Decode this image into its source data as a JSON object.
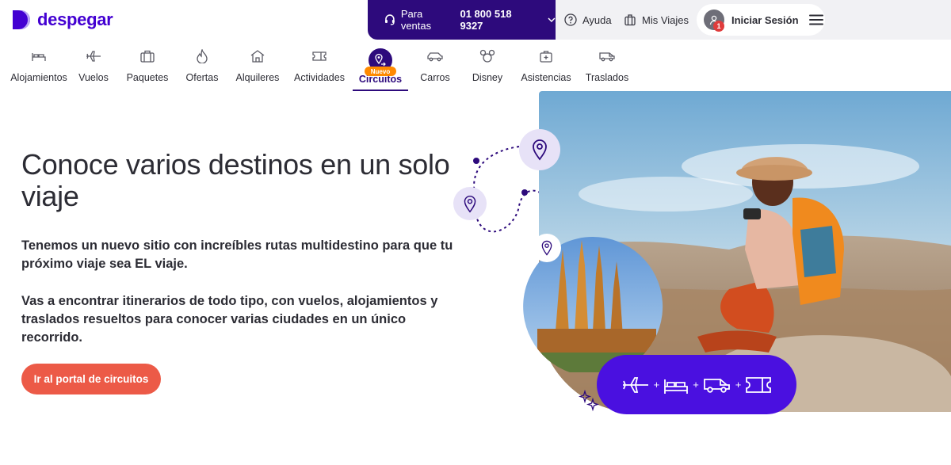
{
  "brand": {
    "name": "despegar",
    "color": "#4300d2"
  },
  "header": {
    "sales_label": "Para ventas",
    "sales_phone": "01 800 518 9327",
    "help_label": "Ayuda",
    "trips_label": "Mis Viajes",
    "login_label": "Iniciar Sesión",
    "notification_count": "1"
  },
  "nav": {
    "items": [
      {
        "label": "Alojamientos",
        "icon": "bed-icon"
      },
      {
        "label": "Vuelos",
        "icon": "plane-icon"
      },
      {
        "label": "Paquetes",
        "icon": "suitcase-icon"
      },
      {
        "label": "Ofertas",
        "icon": "flame-icon"
      },
      {
        "label": "Alquileres",
        "icon": "house-icon"
      },
      {
        "label": "Actividades",
        "icon": "ticket-icon"
      },
      {
        "label": "Circuitos",
        "icon": "route-pin-icon",
        "badge": "Nuevo",
        "active": true
      },
      {
        "label": "Carros",
        "icon": "car-icon"
      },
      {
        "label": "Disney",
        "icon": "mickey-icon"
      },
      {
        "label": "Asistencias",
        "icon": "medical-kit-icon"
      },
      {
        "label": "Traslados",
        "icon": "van-icon"
      }
    ]
  },
  "hero": {
    "title": "Conoce varios destinos en un solo viaje",
    "paragraph1": "Tenemos un nuevo sitio con increíbles rutas multidestino para que tu próximo viaje sea EL viaje.",
    "paragraph2": "Vas a encontrar itinerarios de todo tipo, con vuelos, alojamientos y traslados resueltos para conocer varias ciudades en un único recorrido.",
    "cta_label": "Ir al portal de circuitos"
  },
  "colors": {
    "primary_dark": "#2d0a7c",
    "accent_purple": "#4a10e0",
    "cta": "#ec5a47",
    "badge_orange": "#ff8a00"
  }
}
